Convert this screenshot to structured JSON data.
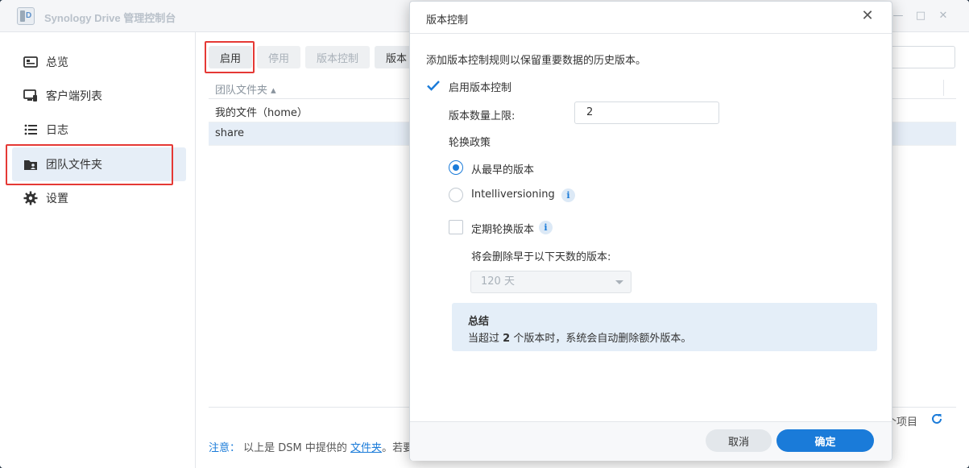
{
  "app": {
    "title": "Synology Drive 管理控制台"
  },
  "sidebar": {
    "items": [
      {
        "label": "总览",
        "icon": "overview-icon"
      },
      {
        "label": "客户端列表",
        "icon": "client-list-icon"
      },
      {
        "label": "日志",
        "icon": "log-icon"
      },
      {
        "label": "团队文件夹",
        "icon": "team-folder-icon"
      },
      {
        "label": "设置",
        "icon": "gear-icon"
      }
    ]
  },
  "toolbar": {
    "enable_label": "启用",
    "disable_label": "停用",
    "version_control_label": "版本控制",
    "partial_label": "版本"
  },
  "grid": {
    "header": "团队文件夹 ▴",
    "rows": [
      "我的文件（home）",
      "share"
    ],
    "footer_count": "个项目"
  },
  "note": {
    "label": "注意：",
    "text": "以上是 DSM 中提供的",
    "link": "文件夹",
    "suffix": "。若要"
  },
  "modal": {
    "title": "版本控制",
    "description": "添加版本控制规则以保留重要数据的历史版本。",
    "enable_checkbox_label": "启用版本控制",
    "max_versions_label": "版本数量上限:",
    "max_versions_value": "2",
    "rotation_label": "轮换政策",
    "radio_oldest_label": "从最早的版本",
    "radio_intelli_label": "Intelliversioning",
    "periodic_label": "定期轮换版本",
    "delete_days_label": "将会删除早于以下天数的版本:",
    "days_value": "120 天",
    "summary_title": "总结",
    "summary_prefix": "当超过",
    "summary_count": "2",
    "summary_suffix": "个版本时，系统会自动删除额外版本。",
    "cancel_label": "取消",
    "ok_label": "确定"
  },
  "colors": {
    "accent": "#1a7bd9",
    "highlight": "#e53935",
    "selected_row": "#e6eef7"
  }
}
